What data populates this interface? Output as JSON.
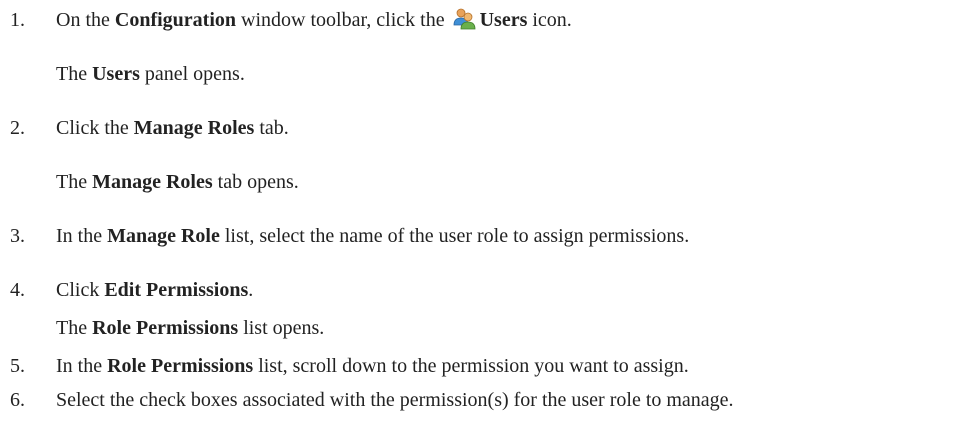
{
  "steps": [
    {
      "number": "1.",
      "parts": [
        "On the ",
        "Configuration",
        " window toolbar, click the ",
        "Users",
        " icon."
      ],
      "result": [
        "The ",
        "Users",
        " panel opens."
      ]
    },
    {
      "number": "2.",
      "parts": [
        "Click the ",
        "Manage Roles",
        " tab."
      ],
      "result": [
        "The ",
        "Manage Roles",
        " tab opens."
      ]
    },
    {
      "number": "3.",
      "parts": [
        "In the ",
        "Manage Role",
        " list, select the name of the user role to assign permissions."
      ]
    },
    {
      "number": "4.",
      "parts": [
        "Click ",
        "Edit Permissions",
        "."
      ],
      "result": [
        "The ",
        "Role Permissions",
        " list opens."
      ]
    },
    {
      "number": "5.",
      "parts": [
        "In the ",
        "Role Permissions",
        " list, scroll down to the permission you want to assign."
      ]
    },
    {
      "number": "6.",
      "parts": [
        "Select the check boxes associated with the permission(s) for the user role to manage."
      ]
    }
  ],
  "icons": {
    "users_icon": "users-icon"
  }
}
